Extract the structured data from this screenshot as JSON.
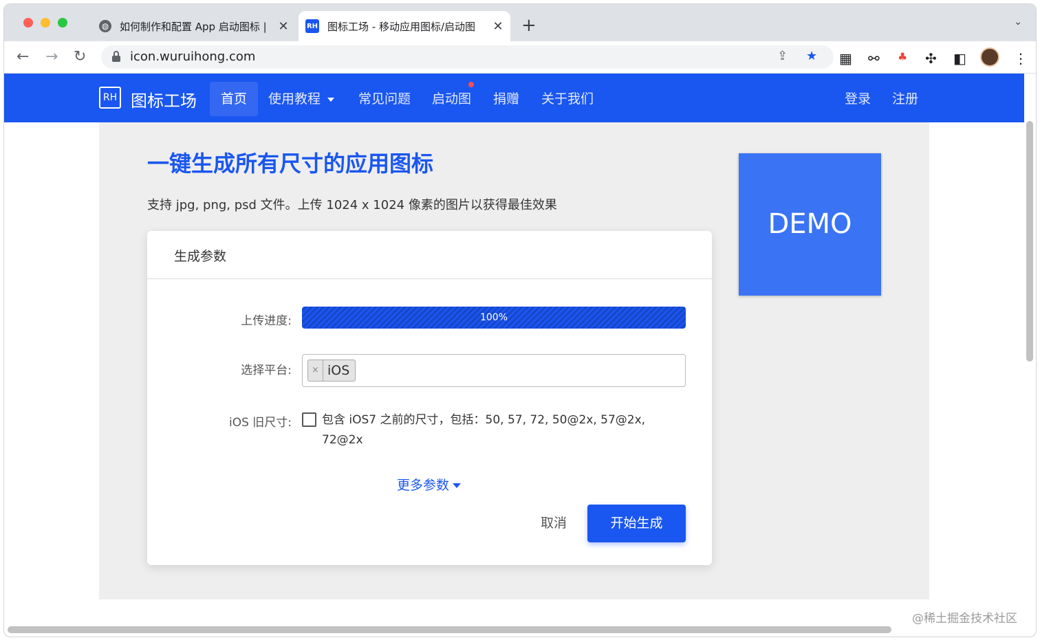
{
  "browser": {
    "tabs": [
      {
        "title": "如何制作和配置 App 启动图标 |",
        "favicon": "globe-icon"
      },
      {
        "title": "图标工场 - 移动应用图标/启动图",
        "favicon": "RH"
      }
    ],
    "new_tab": "+",
    "url": "icon.wuruihong.com"
  },
  "site": {
    "logo_mark": "RH",
    "logo_text": "图标工场",
    "nav": [
      {
        "label": "首页",
        "active": true
      },
      {
        "label": "使用教程"
      },
      {
        "label": "常见问题"
      },
      {
        "label": "启动图"
      },
      {
        "label": "捐赠"
      },
      {
        "label": "关于我们"
      }
    ],
    "login": "登录",
    "register": "注册"
  },
  "hero": {
    "title": "一键生成所有尺寸的应用图标",
    "subtitle": "支持 jpg, png, psd 文件。上传 1024 x 1024 像素的图片以获得最佳效果"
  },
  "card": {
    "title": "生成参数",
    "progress_label": "上传进度:",
    "progress_value": 1.0,
    "progress_text": "100%",
    "platform_label": "选择平台:",
    "platform_chip": "iOS",
    "chip_remove": "×",
    "legacy_label": "iOS 旧尺寸:",
    "legacy_checked": false,
    "legacy_text": "包含 iOS7 之前的尺寸，包括：50, 57, 72, 50@2x, 57@2x, 72@2x",
    "more_params": "更多参数",
    "cancel": "取消",
    "submit": "开始生成"
  },
  "demo": {
    "text": "DEMO"
  },
  "watermark": "@稀土掘金技术社区",
  "colors": {
    "brand": "#1a56f0",
    "demo": "#3a74f5"
  }
}
